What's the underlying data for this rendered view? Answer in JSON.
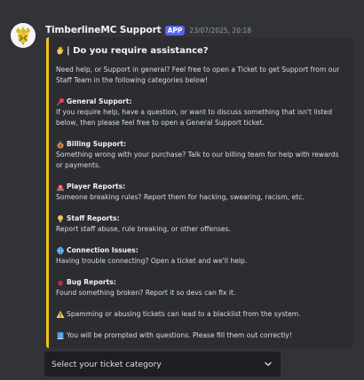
{
  "author": {
    "name": "TimberlineMC Support",
    "badge": "APP",
    "timestamp": "23/07/2025, 20:18"
  },
  "embed": {
    "accent_color": "#f0c419",
    "title": "| Do you require assistance?",
    "title_icon": "raised-hand-emoji",
    "intro": "Need help, or Support in general? Feel free to open a Ticket to get Support from our Staff Team in the following categories below!",
    "sections": [
      {
        "icon": "pushpin-emoji",
        "title": "General Support:",
        "text": "If you require help, have a question, or want to discuss something that isn't listed below, then please feel free to open a General Support ticket."
      },
      {
        "icon": "money-bag-emoji",
        "title": "Billing Support:",
        "text": "Something wrong with your purchase? Talk to our billing team for help with rewards or payments."
      },
      {
        "icon": "siren-emoji",
        "title": "Player Reports:",
        "text": "Someone breaking rules? Report them for hacking, swearing, racism, etc."
      },
      {
        "icon": "lightbulb-emoji",
        "title": "Staff Reports:",
        "text": "Report staff abuse, rule breaking, or other offenses."
      },
      {
        "icon": "globe-emoji",
        "title": "Connection Issues:",
        "text": "Having trouble connecting? Open a ticket and we'll help."
      },
      {
        "icon": "bug-emoji",
        "title": "Bug Reports:",
        "text": "Found something broken? Report it so devs can fix it."
      }
    ],
    "warning": "Spamming or abusing tickets can lead to a blacklist from the system.",
    "warning_icon": "warning-emoji",
    "note": "You will be prompted with questions. Please fill them out correctly!",
    "note_icon": "book-emoji"
  },
  "select_menu": {
    "placeholder": "Select your ticket category"
  }
}
